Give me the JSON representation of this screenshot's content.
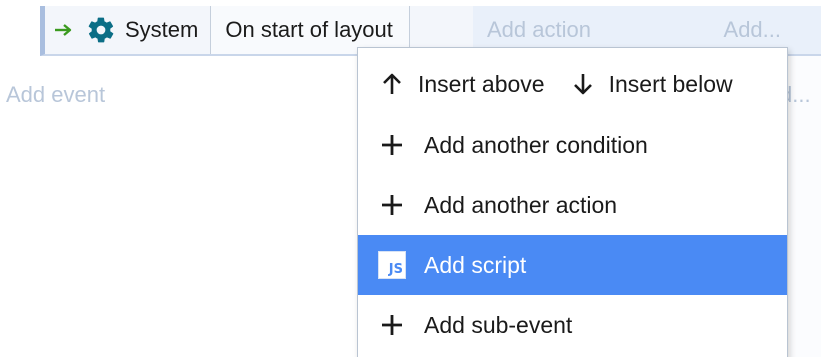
{
  "event": {
    "object_name": "System",
    "condition_text": "On start of layout",
    "add_action_label": "Add action",
    "add_more_label": "Add..."
  },
  "sheet": {
    "add_event_label": "Add event",
    "right_hint": "d..."
  },
  "context_menu": {
    "insert_above_label": "Insert above",
    "insert_below_label": "Insert below",
    "items": [
      {
        "label": "Add another condition",
        "icon": "plus-icon"
      },
      {
        "label": "Add another action",
        "icon": "plus-icon"
      },
      {
        "label": "Add script",
        "icon": "js-icon",
        "icon_text": "JS",
        "selected": true
      },
      {
        "label": "Add sub-event",
        "icon": "plus-icon"
      }
    ]
  },
  "colors": {
    "selection": "#4a8af4",
    "placeholder_text": "#b8c6d9",
    "event_background": "#e9f0fa",
    "gear": "#0b6e86",
    "trigger_arrow": "#3a9a1f"
  }
}
